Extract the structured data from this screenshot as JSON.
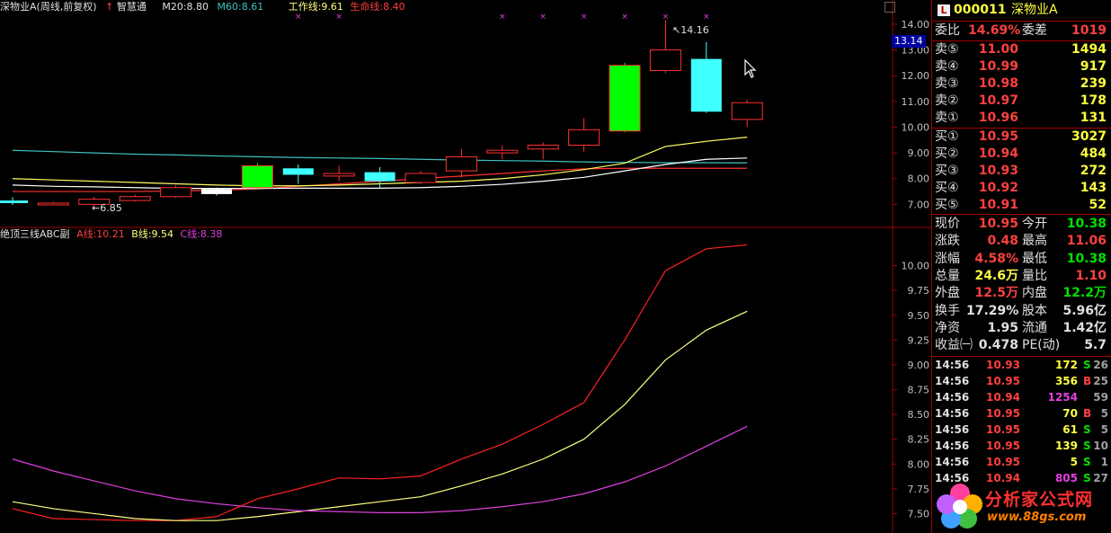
{
  "header": {
    "title": "深物业A(周线,前复权)",
    "app": "智慧通",
    "ma20_label": "M20:8.80",
    "ma60_label": "M60:8.61",
    "work_line": "工作线:9.61",
    "life_line": "生命线:8.40"
  },
  "indicator_header": {
    "title": "绝顶三线ABC副",
    "a_label": "A线:10.21",
    "b_label": "B线:9.54",
    "c_label": "C线:8.38"
  },
  "annotations": {
    "high_label": "14.16",
    "low_label": "6.85",
    "price_marker": "13.14"
  },
  "colors": {
    "up": "#ff3030",
    "down_fill": "#00ff00",
    "cyan": "#40ffff",
    "ma20": "#ffffff",
    "ma60": "#40c0c0",
    "work": "#ffff60",
    "life": "#ff3030",
    "a_line": "#ff2020",
    "b_line": "#ffff80",
    "c_line": "#e040e0",
    "panel_border": "#a00000"
  },
  "chart_data": [
    {
      "type": "candlestick",
      "title": "深物业A(周线,前复权)",
      "y_ticks": [
        "7.00",
        "8.00",
        "9.00",
        "10.00",
        "11.00",
        "12.00",
        "13.00",
        "14.00"
      ],
      "ylim": [
        6.35,
        14.45
      ],
      "candles": [
        {
          "o": 7.05,
          "c": 7.15,
          "h": 7.28,
          "l": 6.98,
          "color": "cyan"
        },
        {
          "o": 7.05,
          "c": 7.05,
          "h": 7.1,
          "l": 7.0,
          "color": "red"
        },
        {
          "o": 7.0,
          "c": 7.2,
          "h": 7.3,
          "l": 6.85,
          "color": "red"
        },
        {
          "o": 7.15,
          "c": 7.3,
          "h": 7.38,
          "l": 7.1,
          "color": "red"
        },
        {
          "o": 7.3,
          "c": 7.65,
          "h": 7.75,
          "l": 7.25,
          "color": "red"
        },
        {
          "o": 7.4,
          "c": 7.6,
          "h": 7.65,
          "l": 7.35,
          "color": "white"
        },
        {
          "o": 8.5,
          "c": 7.65,
          "h": 8.6,
          "l": 7.6,
          "color": "green"
        },
        {
          "o": 8.4,
          "c": 8.15,
          "h": 8.55,
          "l": 7.8,
          "color": "cyan"
        },
        {
          "o": 8.1,
          "c": 8.2,
          "h": 8.5,
          "l": 7.9,
          "color": "red"
        },
        {
          "o": 8.25,
          "c": 7.9,
          "h": 8.45,
          "l": 7.65,
          "color": "cyan"
        },
        {
          "o": 7.85,
          "c": 8.2,
          "h": 8.3,
          "l": 7.8,
          "color": "red"
        },
        {
          "o": 8.3,
          "c": 8.85,
          "h": 9.15,
          "l": 8.05,
          "color": "red"
        },
        {
          "o": 9.0,
          "c": 9.1,
          "h": 9.3,
          "l": 8.75,
          "color": "red"
        },
        {
          "o": 9.15,
          "c": 9.3,
          "h": 9.4,
          "l": 8.75,
          "color": "red"
        },
        {
          "o": 9.3,
          "c": 9.9,
          "h": 10.35,
          "l": 9.05,
          "color": "red"
        },
        {
          "o": 12.4,
          "c": 9.85,
          "h": 12.5,
          "l": 9.8,
          "color": "green"
        },
        {
          "o": 12.2,
          "c": 13.0,
          "h": 14.16,
          "l": 12.1,
          "color": "red"
        },
        {
          "o": 12.65,
          "c": 10.6,
          "h": 13.3,
          "l": 10.55,
          "color": "cyan"
        },
        {
          "o": 10.3,
          "c": 10.95,
          "h": 11.06,
          "l": 10.0,
          "color": "red"
        }
      ],
      "ma20": [
        7.75,
        7.7,
        7.68,
        7.65,
        7.62,
        7.62,
        7.62,
        7.63,
        7.63,
        7.63,
        7.65,
        7.7,
        7.78,
        7.9,
        8.05,
        8.3,
        8.55,
        8.75,
        8.8
      ],
      "ma60": [
        9.1,
        9.05,
        9.0,
        8.95,
        8.92,
        8.88,
        8.85,
        8.82,
        8.8,
        8.78,
        8.75,
        8.72,
        8.7,
        8.68,
        8.65,
        8.63,
        8.62,
        8.62,
        8.61
      ],
      "work_line": [
        8.0,
        7.95,
        7.9,
        7.85,
        7.8,
        7.75,
        7.72,
        7.72,
        7.75,
        7.8,
        7.85,
        7.9,
        8.0,
        8.15,
        8.35,
        8.6,
        9.25,
        9.45,
        9.61
      ],
      "life_line": [
        7.5,
        7.5,
        7.5,
        7.5,
        7.52,
        7.55,
        7.6,
        7.7,
        7.8,
        7.9,
        8.0,
        8.1,
        8.2,
        8.3,
        8.38,
        8.4,
        8.4,
        8.4,
        8.4
      ]
    },
    {
      "type": "line",
      "title": "绝顶三线ABC副",
      "y_ticks": [
        "7.50",
        "7.75",
        "8.00",
        "8.25",
        "8.50",
        "8.75",
        "9.00",
        "9.25",
        "9.50",
        "9.75",
        "10.00"
      ],
      "ylim": [
        7.35,
        10.25
      ],
      "series": [
        {
          "name": "A线",
          "values": [
            7.55,
            7.45,
            7.44,
            7.43,
            7.43,
            7.47,
            7.65,
            7.75,
            7.86,
            7.85,
            7.88,
            8.05,
            8.2,
            8.4,
            8.62,
            9.25,
            9.95,
            10.17,
            10.21
          ]
        },
        {
          "name": "B线",
          "values": [
            7.62,
            7.55,
            7.5,
            7.45,
            7.43,
            7.43,
            7.47,
            7.52,
            7.57,
            7.62,
            7.67,
            7.78,
            7.9,
            8.05,
            8.25,
            8.6,
            9.05,
            9.35,
            9.54
          ]
        },
        {
          "name": "C线",
          "values": [
            8.05,
            7.93,
            7.83,
            7.73,
            7.65,
            7.6,
            7.56,
            7.53,
            7.52,
            7.51,
            7.51,
            7.53,
            7.57,
            7.62,
            7.7,
            7.82,
            7.98,
            8.18,
            8.38
          ]
        }
      ]
    }
  ],
  "quote_panel": {
    "code": "000011",
    "name": "深物业A",
    "weibi": {
      "label": "委比",
      "value": "14.69%",
      "label2": "委差",
      "value2": "1019"
    },
    "sell": [
      {
        "label": "卖⑤",
        "price": "11.00",
        "vol": "1494"
      },
      {
        "label": "卖④",
        "price": "10.99",
        "vol": "917"
      },
      {
        "label": "卖③",
        "price": "10.98",
        "vol": "239"
      },
      {
        "label": "卖②",
        "price": "10.97",
        "vol": "178"
      },
      {
        "label": "卖①",
        "price": "10.96",
        "vol": "131"
      }
    ],
    "buy": [
      {
        "label": "买①",
        "price": "10.95",
        "vol": "3027"
      },
      {
        "label": "买②",
        "price": "10.94",
        "vol": "484"
      },
      {
        "label": "买③",
        "price": "10.93",
        "vol": "272"
      },
      {
        "label": "买④",
        "price": "10.92",
        "vol": "143"
      },
      {
        "label": "买⑤",
        "price": "10.91",
        "vol": "52"
      }
    ],
    "stats": [
      {
        "l1": "现价",
        "v1": "10.95",
        "l2": "今开",
        "v2": "10.38",
        "c1": "red",
        "c2": "green"
      },
      {
        "l1": "涨跌",
        "v1": "0.48",
        "l2": "最高",
        "v2": "11.06",
        "c1": "red",
        "c2": "red"
      },
      {
        "l1": "涨幅",
        "v1": "4.58%",
        "l2": "最低",
        "v2": "10.38",
        "c1": "red",
        "c2": "green"
      },
      {
        "l1": "总量",
        "v1": "24.6万",
        "l2": "量比",
        "v2": "1.10",
        "c1": "yellow",
        "c2": "red"
      },
      {
        "l1": "外盘",
        "v1": "12.5万",
        "l2": "内盘",
        "v2": "12.2万",
        "c1": "red",
        "c2": "green"
      },
      {
        "l1": "换手",
        "v1": "17.29%",
        "l2": "股本",
        "v2": "5.96亿",
        "c1": "white",
        "c2": "white"
      },
      {
        "l1": "净资",
        "v1": "1.95",
        "l2": "流通",
        "v2": "1.42亿",
        "c1": "white",
        "c2": "white"
      },
      {
        "l1": "收益㈠",
        "v1": "0.478",
        "l2": "PE(动)",
        "v2": "5.7",
        "c1": "white",
        "c2": "white"
      }
    ],
    "ticks": [
      {
        "time": "14:56",
        "price": "10.93",
        "vol": "172",
        "bs": "S",
        "n": "26",
        "vc": "yellow"
      },
      {
        "time": "14:56",
        "price": "10.95",
        "vol": "356",
        "bs": "B",
        "n": "25",
        "vc": "yellow"
      },
      {
        "time": "14:56",
        "price": "10.94",
        "vol": "1254",
        "bs": "",
        "n": "59",
        "vc": "magenta"
      },
      {
        "time": "14:56",
        "price": "10.95",
        "vol": "70",
        "bs": "B",
        "n": "5",
        "vc": "yellow"
      },
      {
        "time": "14:56",
        "price": "10.95",
        "vol": "61",
        "bs": "S",
        "n": "5",
        "vc": "yellow"
      },
      {
        "time": "14:56",
        "price": "10.95",
        "vol": "139",
        "bs": "S",
        "n": "10",
        "vc": "yellow"
      },
      {
        "time": "14:56",
        "price": "10.95",
        "vol": "5",
        "bs": "S",
        "n": "1",
        "vc": "yellow"
      },
      {
        "time": "14:56",
        "price": "10.94",
        "vol": "805",
        "bs": "S",
        "n": "27",
        "vc": "magenta"
      }
    ]
  },
  "watermark": {
    "text": "分析家公式网",
    "url": "www.88gs.com"
  }
}
